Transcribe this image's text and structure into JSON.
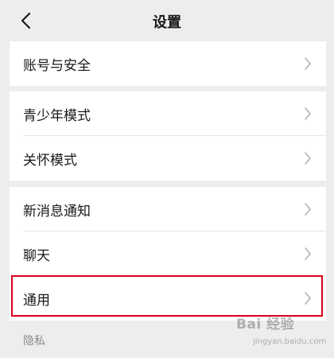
{
  "nav": {
    "title": "设置",
    "back_icon": "chevron-left-icon"
  },
  "groups": [
    {
      "items": [
        {
          "label": "账号与安全"
        }
      ]
    },
    {
      "items": [
        {
          "label": "青少年模式"
        },
        {
          "label": "关怀模式"
        }
      ]
    },
    {
      "items": [
        {
          "label": "新消息通知"
        },
        {
          "label": "聊天"
        },
        {
          "label": "通用",
          "highlighted": true
        }
      ]
    }
  ],
  "section_label": "隐私",
  "watermark": {
    "text": "Bai 经验",
    "sub": "jingyan.baidu.com"
  },
  "colors": {
    "background": "#ededed",
    "card": "#ffffff",
    "highlight": "#d9001b",
    "muted_text": "#8a8a8a"
  }
}
